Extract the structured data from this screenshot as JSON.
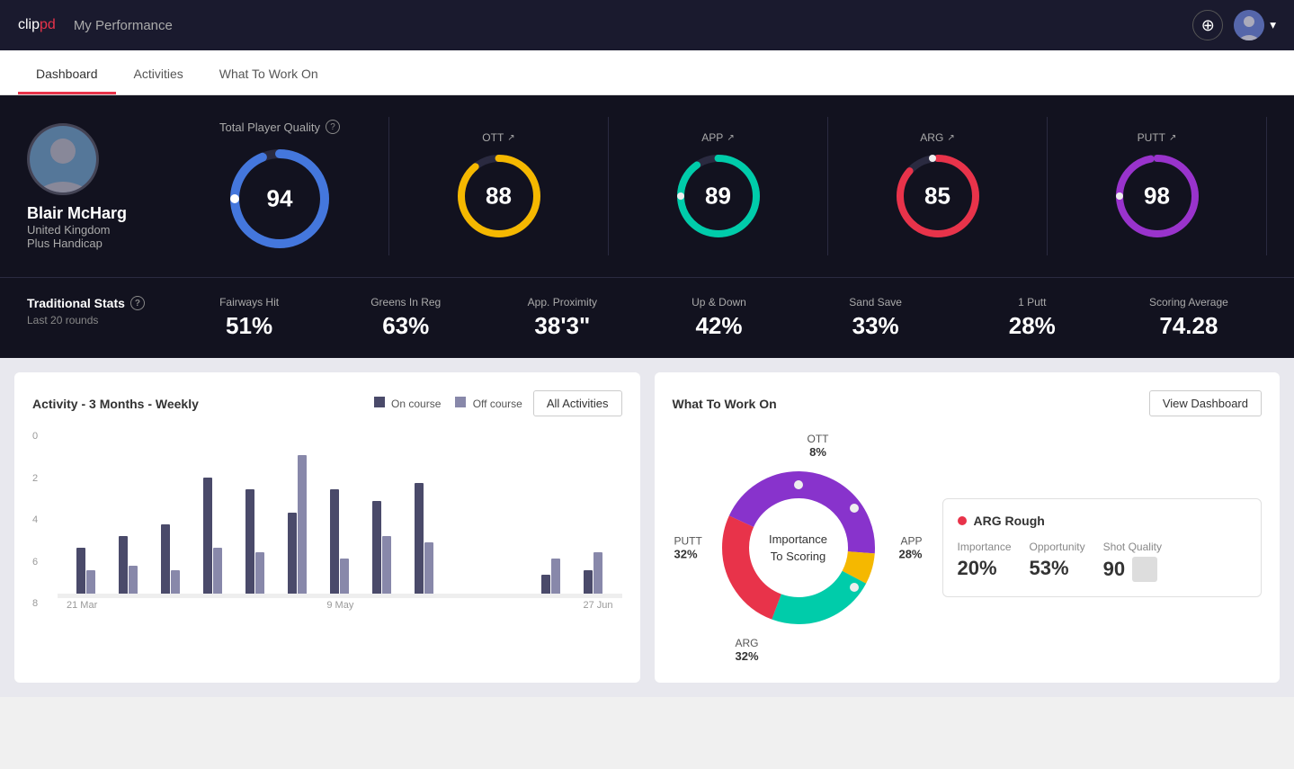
{
  "app": {
    "logo": "clippd",
    "logo_clip": "clip",
    "logo_pd": "pd",
    "header_title": "My Performance",
    "add_icon": "+",
    "chevron_down": "▾"
  },
  "tabs": [
    {
      "id": "dashboard",
      "label": "Dashboard",
      "active": true
    },
    {
      "id": "activities",
      "label": "Activities",
      "active": false
    },
    {
      "id": "what_to_work_on",
      "label": "What To Work On",
      "active": false
    }
  ],
  "player": {
    "name": "Blair McHarg",
    "country": "United Kingdom",
    "handicap": "Plus Handicap"
  },
  "tpq": {
    "label": "Total Player Quality",
    "value": 94,
    "color": "#4477dd"
  },
  "scores": [
    {
      "id": "ott",
      "label": "OTT",
      "value": 88,
      "color": "#f5b800",
      "trail_color": "#2a2a40"
    },
    {
      "id": "app",
      "label": "APP",
      "value": 89,
      "color": "#00ccaa",
      "trail_color": "#2a2a40"
    },
    {
      "id": "arg",
      "label": "ARG",
      "value": 85,
      "color": "#e8334a",
      "trail_color": "#2a2a40"
    },
    {
      "id": "putt",
      "label": "PUTT",
      "value": 98,
      "color": "#9933cc",
      "trail_color": "#2a2a40"
    }
  ],
  "traditional_stats": {
    "title": "Traditional Stats",
    "subtitle": "Last 20 rounds",
    "items": [
      {
        "name": "Fairways Hit",
        "value": "51%"
      },
      {
        "name": "Greens In Reg",
        "value": "63%"
      },
      {
        "name": "App. Proximity",
        "value": "38'3\""
      },
      {
        "name": "Up & Down",
        "value": "42%"
      },
      {
        "name": "Sand Save",
        "value": "33%"
      },
      {
        "name": "1 Putt",
        "value": "28%"
      },
      {
        "name": "Scoring Average",
        "value": "74.28"
      }
    ]
  },
  "activity_chart": {
    "title": "Activity - 3 Months - Weekly",
    "legend_on_course": "On course",
    "legend_off_course": "Off course",
    "all_activities_btn": "All Activities",
    "y_labels": [
      "0",
      "2",
      "4",
      "6",
      "8"
    ],
    "x_labels": [
      "21 Mar",
      "9 May",
      "27 Jun"
    ],
    "bars": [
      {
        "on": 20,
        "off": 10
      },
      {
        "on": 25,
        "off": 12
      },
      {
        "on": 30,
        "off": 10
      },
      {
        "on": 50,
        "off": 20
      },
      {
        "on": 45,
        "off": 18
      },
      {
        "on": 35,
        "off": 60
      },
      {
        "on": 45,
        "off": 15
      },
      {
        "on": 40,
        "off": 25
      },
      {
        "on": 48,
        "off": 22
      },
      {
        "on": 0,
        "off": 0
      },
      {
        "on": 0,
        "off": 0
      },
      {
        "on": 8,
        "off": 15
      },
      {
        "on": 10,
        "off": 18
      }
    ]
  },
  "what_to_work_on": {
    "title": "What To Work On",
    "view_dashboard_btn": "View Dashboard",
    "donut_center_line1": "Importance",
    "donut_center_line2": "To Scoring",
    "segments": [
      {
        "id": "ott",
        "label": "OTT",
        "pct": "8%",
        "color": "#f5b800",
        "degrees": 28.8
      },
      {
        "id": "app",
        "label": "APP",
        "pct": "28%",
        "color": "#00ccaa",
        "degrees": 100.8
      },
      {
        "id": "arg",
        "label": "ARG",
        "pct": "32%",
        "color": "#e8334a",
        "degrees": 115.2
      },
      {
        "id": "putt",
        "label": "PUTT",
        "pct": "32%",
        "color": "#8833cc",
        "degrees": 115.2
      }
    ],
    "info_card": {
      "title": "ARG Rough",
      "importance_label": "Importance",
      "importance_value": "20%",
      "opportunity_label": "Opportunity",
      "opportunity_value": "53%",
      "shot_quality_label": "Shot Quality",
      "shot_quality_value": "90"
    }
  }
}
